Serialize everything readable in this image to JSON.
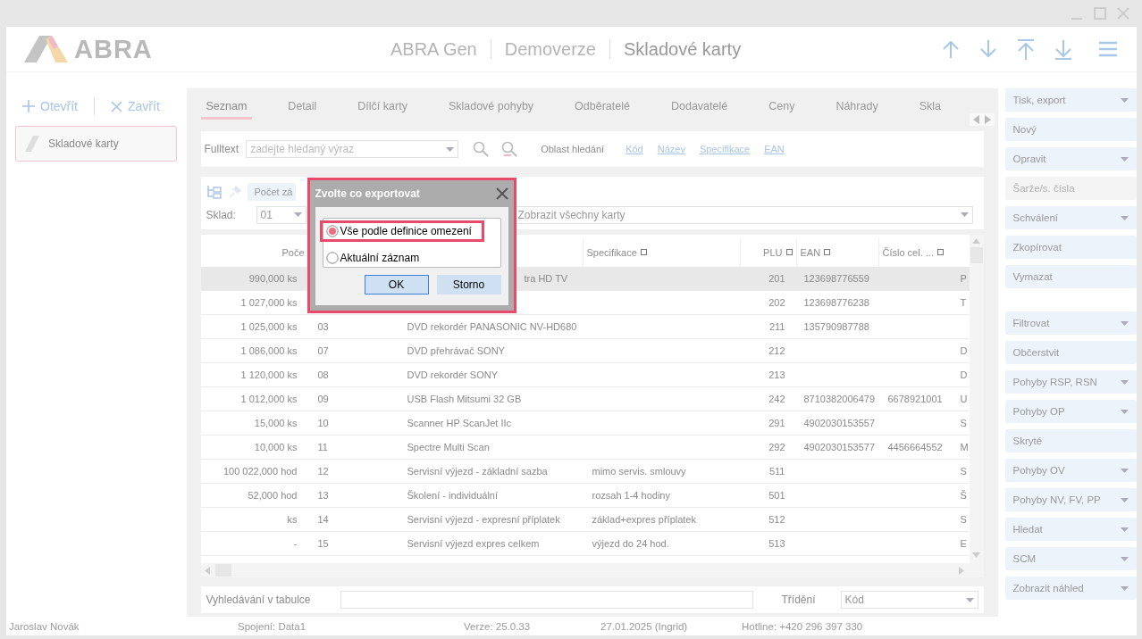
{
  "header": {
    "logo": "ABRA",
    "titles": [
      "ABRA Gen",
      "Demoverze",
      "Skladové karty"
    ]
  },
  "left_panel": {
    "actions": [
      {
        "label": "Otevřít",
        "kind": "open"
      },
      {
        "label": "Zavřít",
        "kind": "close"
      }
    ],
    "cards": [
      {
        "label": "Skladové karty",
        "selected": true
      }
    ]
  },
  "tabs": [
    {
      "label": "Seznam",
      "selected": true
    },
    {
      "label": "Detail",
      "selected": false
    },
    {
      "label": "Dílčí karty",
      "selected": false
    },
    {
      "label": "Skladové pohyby",
      "selected": false
    },
    {
      "label": "Odběratelé",
      "selected": false
    },
    {
      "label": "Dodavatelé",
      "selected": false
    },
    {
      "label": "Ceny",
      "selected": false
    },
    {
      "label": "Náhrady",
      "selected": false
    },
    {
      "label": "Skla",
      "selected": false
    }
  ],
  "search": {
    "label": "Fulltext",
    "placeholder": "zadejte hledaný výraz",
    "area_label": "Oblast hledání",
    "areas": [
      "Kód",
      "Název",
      "Specifikace",
      "EAN"
    ]
  },
  "toolbar": {
    "count_button": "Počet zá",
    "store_label": "Sklad:",
    "store_value": "01",
    "filter_value": "Zobrazit všechny karty"
  },
  "table": {
    "columns": [
      {
        "label": "Poče",
        "kind": "quantity"
      },
      null,
      null,
      {
        "label": "Specifikace",
        "kind": "text"
      },
      {
        "label": "PLU",
        "kind": "number"
      },
      {
        "label": "EAN",
        "kind": "text"
      },
      {
        "label": "Číslo cel. ...",
        "kind": "text"
      },
      null
    ],
    "rows": [
      {
        "selected": true,
        "cells": [
          "990,000 ks",
          null,
          {
            "text": "tra HD TV",
            "covered": true
          },
          null,
          "201",
          "123698776559",
          null,
          "P"
        ]
      },
      {
        "selected": false,
        "cells": [
          "1 027,000 ks",
          null,
          null,
          null,
          "202",
          "123698776238",
          null,
          "T"
        ]
      },
      {
        "selected": false,
        "cells": [
          "1 025,000 ks",
          "03",
          "DVD rekordér PANASONIC NV-HD680",
          null,
          "211",
          "135790987788",
          null,
          null
        ]
      },
      {
        "selected": false,
        "cells": [
          "1 086,000 ks",
          "07",
          "DVD přehrávač SONY",
          null,
          "212",
          null,
          null,
          "D"
        ]
      },
      {
        "selected": false,
        "cells": [
          "1 120,000 ks",
          "08",
          "DVD rekordér SONY",
          null,
          "213",
          null,
          null,
          "D"
        ]
      },
      {
        "selected": false,
        "cells": [
          "1 012,000 ks",
          "09",
          "USB Flash Mitsumi 32 GB",
          null,
          "242",
          "8710382006479",
          "6678921001",
          "U"
        ]
      },
      {
        "selected": false,
        "cells": [
          "15,000 ks",
          "10",
          "Scanner HP ScanJet IIc",
          null,
          "291",
          "4902030153557",
          null,
          "S"
        ]
      },
      {
        "selected": false,
        "cells": [
          "10,000 ks",
          "11",
          "Spectre Multi Scan",
          null,
          "292",
          "4902030153577",
          "4456664552",
          "M"
        ]
      },
      {
        "selected": false,
        "cells": [
          "100 022,000 hod",
          "12",
          "Servisní výjezd - základní sazba",
          "mimo servis. smlouvy",
          "511",
          null,
          null,
          "S"
        ]
      },
      {
        "selected": false,
        "cells": [
          "52,000 hod",
          "13",
          "Školení - individuální",
          "rozsah 1-4 hodiny",
          "501",
          null,
          null,
          "Š"
        ]
      },
      {
        "selected": false,
        "cells": [
          "ks",
          "14",
          "Servisní výjezd - expresní příplatek",
          "základ+expres příplatek",
          "512",
          null,
          null,
          "S"
        ]
      },
      {
        "selected": false,
        "cells": [
          "-",
          "15",
          "Servisní výjezd expres celkem",
          "výjezd do 24 hod.",
          "513",
          null,
          null,
          "E"
        ]
      }
    ]
  },
  "bottom": {
    "search_label": "Vyhledávání v tabulce",
    "sort_label": "Třídění",
    "sort_value": "Kód"
  },
  "actions": [
    [
      {
        "label": "Tisk, export",
        "kind": "dropdown"
      },
      {
        "label": "Nový",
        "kind": "plain"
      },
      {
        "label": "Opravit",
        "kind": "dropdown"
      },
      {
        "label": "Šarže/s. čísla",
        "kind": "plain",
        "disabled": true
      },
      {
        "label": "Schválení",
        "kind": "dropdown"
      },
      {
        "label": "Zkopírovat",
        "kind": "plain"
      },
      {
        "label": "Vymazat",
        "kind": "plain"
      }
    ],
    [
      {
        "label": "Filtrovat",
        "kind": "dropdown"
      },
      {
        "label": "Občerstvit",
        "kind": "plain"
      },
      {
        "label": "Pohyby RSP, RSN",
        "kind": "dropdown"
      },
      {
        "label": "Pohyby OP",
        "kind": "dropdown"
      },
      {
        "label": "Skryté",
        "kind": "plain"
      },
      {
        "label": "Pohyby OV",
        "kind": "dropdown"
      },
      {
        "label": "Pohyby NV, FV, PP",
        "kind": "dropdown"
      },
      {
        "label": "Hledat",
        "kind": "dropdown"
      },
      {
        "label": "SCM",
        "kind": "dropdown"
      },
      {
        "label": "Zobrazit náhled",
        "kind": "dropdown"
      }
    ]
  ],
  "status_bar": [
    "Jaroslav Novák",
    "Spojení: Data1",
    "Verze: 25.0.33",
    "27.01.2025 (Ingrid)",
    "Hotline: +420 296 397 330"
  ],
  "dialog": {
    "title": "Zvolte co exportovat",
    "highlighted": true,
    "options": [
      {
        "label": "Vše podle definice omezení",
        "selected": true,
        "highlighted": true
      },
      {
        "label": "Aktuální záznam",
        "selected": false,
        "highlighted": false
      }
    ],
    "buttons": [
      "OK",
      "Storno"
    ]
  }
}
